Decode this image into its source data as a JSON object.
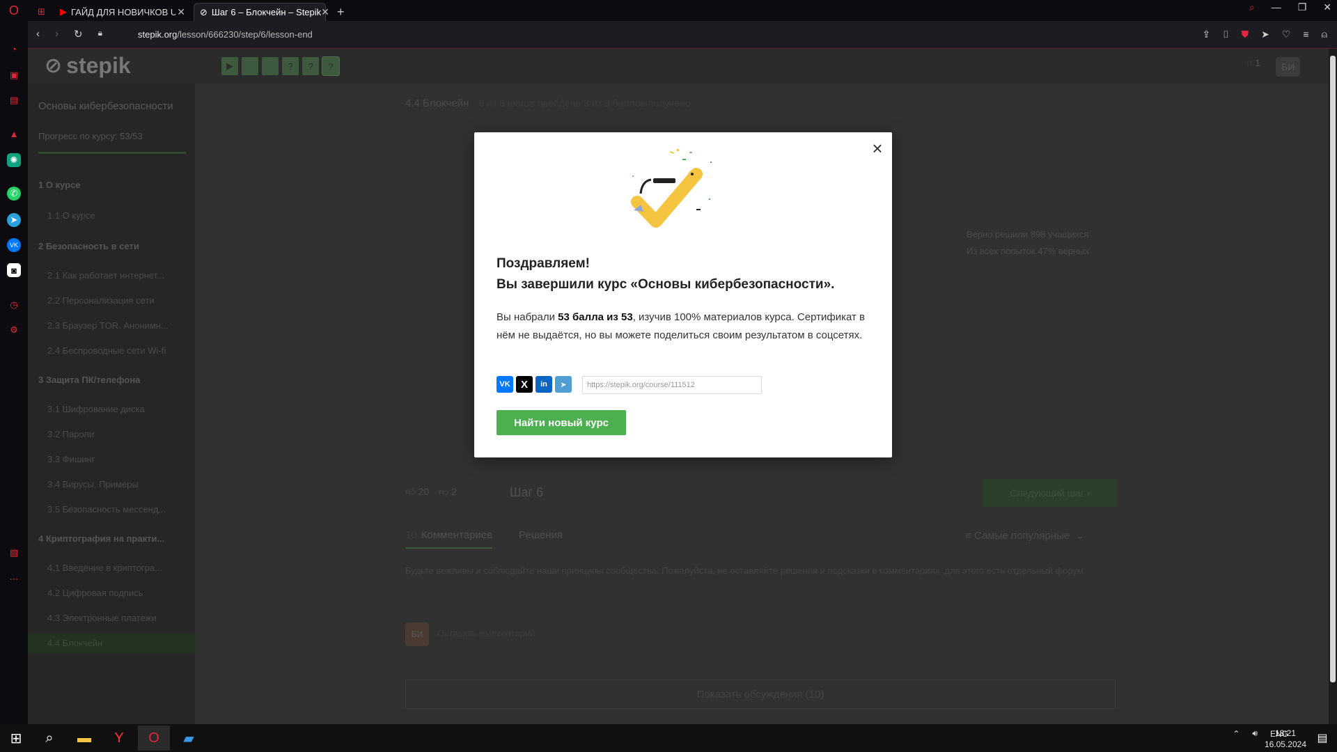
{
  "browser": {
    "tabs": [
      {
        "title": "",
        "icon": "gamepad-icon"
      },
      {
        "title": "ГАЙД ДЛЯ НОВИЧКОВ UF",
        "icon": "youtube-icon"
      },
      {
        "title": "Шаг 6 – Блокчейн – Stepik",
        "icon": "stepik-icon"
      }
    ],
    "url_host": "stepik.org",
    "url_path": "/lesson/666230/step/6/lesson-end",
    "new_tab": "+"
  },
  "stepik": {
    "logo": "stepik",
    "course_title": "Основы кибербезопасности",
    "course_progress": "Прогресс по курсу: 53/53",
    "lessons": [
      {
        "label": "1  О курсе",
        "type": "section"
      },
      {
        "label": "1.1  О курсе",
        "type": "lesson"
      },
      {
        "label": "2  Безопасность в сети",
        "type": "section"
      },
      {
        "label": "2.1  Как работает интернет...",
        "type": "lesson"
      },
      {
        "label": "2.2  Персонализация сети",
        "type": "lesson"
      },
      {
        "label": "2.3  Браузер TOR. Анонимн...",
        "type": "lesson"
      },
      {
        "label": "2.4  Беспроводные сети Wi-fi",
        "type": "lesson"
      },
      {
        "label": "3  Защита ПК/телефона",
        "type": "section"
      },
      {
        "label": "3.1  Шифрование диска",
        "type": "lesson"
      },
      {
        "label": "3.2  Пароли",
        "type": "lesson"
      },
      {
        "label": "3.3  Фишинг",
        "type": "lesson"
      },
      {
        "label": "3.4  Вирусы. Примеры",
        "type": "lesson"
      },
      {
        "label": "3.5  Безопасность мессенд...",
        "type": "lesson"
      },
      {
        "label": "4  Криптография на практи...",
        "type": "section"
      },
      {
        "label": "4.1  Введение в криптогра...",
        "type": "lesson"
      },
      {
        "label": "4.2  Цифровая подпись",
        "type": "lesson"
      },
      {
        "label": "4.3  Электронные платежи",
        "type": "lesson"
      },
      {
        "label": "4.4  Блокчейн",
        "type": "active"
      }
    ],
    "breadcrumb": "4.4 Блокчейн",
    "breadcrumb_progress": "6 из 6 шагов пройдено   3 из 3 баллов  получено",
    "stats_line1": "Верно решили 898 учащихся",
    "stats_line2": "Из всех попыток 47% верных",
    "likes": "20",
    "dislikes": "2",
    "step_label": "Шаг 6",
    "next_step": "Следующий шаг",
    "comments_count": "10",
    "tab_comments": "Комментариев",
    "tab_solutions": "Решения",
    "sort_label": "Самые популярные",
    "rules_text": "Будьте вежливы и соблюдайте наши принципы сообщества. Пожалуйста, не оставляйте решения и подсказки в комментариях, для этого есть отдельный форум.",
    "avatar_initials": "БИ",
    "leave_comment": "Оставить комментарий",
    "show_discussion": "Показать обсуждения (10)",
    "header_badge": "1",
    "header_avatar": "БИ"
  },
  "modal": {
    "heading_line1": "Поздравляем!",
    "heading_line2": "Вы завершили курс «Основы кибербезопасности».",
    "text_part1": "Вы набрали ",
    "text_bold": "53 балла из 53",
    "text_part2": ", изучив 100% материалов курса. Сертификат в нём не выдаётся, но вы можете поделиться своим результатом в соцсетях.",
    "share_buttons": [
      {
        "name": "vk",
        "label": "VK",
        "color": "#0077ff"
      },
      {
        "name": "x",
        "label": "X",
        "color": "#000000"
      },
      {
        "name": "linkedin",
        "label": "in",
        "color": "#0a66c2"
      },
      {
        "name": "telegram",
        "label": "➤",
        "color": "#4f9fd5"
      }
    ],
    "share_url": "https://stepik.org/course/111512",
    "find_course_button": "Найти новый курс",
    "close_icon": "close-icon"
  },
  "taskbar": {
    "lang": "ENG",
    "time": "18:21",
    "date": "16.05.2024"
  },
  "colors": {
    "accent_green": "#4caf50",
    "opera_red": "#e3263b"
  }
}
